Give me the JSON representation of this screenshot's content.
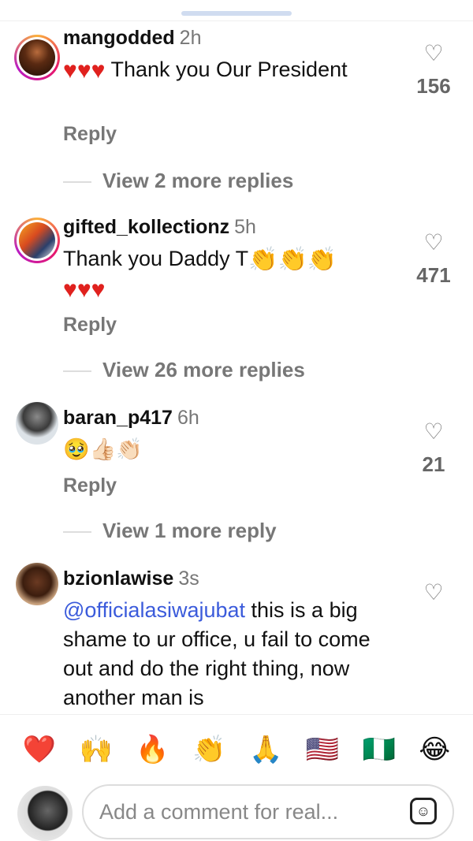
{
  "comments": [
    {
      "username": "mangodded",
      "time": "2h",
      "text_parts": [
        "♥♥♥",
        " Thank you Our President"
      ],
      "likes": "156",
      "reply": "Reply",
      "view_more": "View 2 more replies"
    },
    {
      "username": "gifted_kollectionz",
      "time": "5h",
      "text_parts": [
        "Thank you Daddy T",
        "👏👏👏",
        "♥♥♥"
      ],
      "likes": "471",
      "reply": "Reply",
      "view_more": "View 26 more replies"
    },
    {
      "username": "baran_p417",
      "time": "6h",
      "text_parts": [
        "🥹👍🏻👏🏻"
      ],
      "likes": "21",
      "reply": "Reply",
      "view_more": "View 1 more reply"
    },
    {
      "username": "bzionlawise",
      "time": "3s",
      "mention": "@officialasiwajubat",
      "text": " this is a big shame to ur office, u fail to come out and do the right thing, now another man is"
    }
  ],
  "reactions": [
    "❤️",
    "🙌",
    "🔥",
    "👏",
    "🙏",
    "🇺🇸",
    "🇳🇬",
    "😂"
  ],
  "composer": {
    "placeholder": "Add a comment for real..."
  },
  "colors": {
    "mention": "#3b5bdb",
    "heart": "#e0211e",
    "muted": "#777777"
  }
}
